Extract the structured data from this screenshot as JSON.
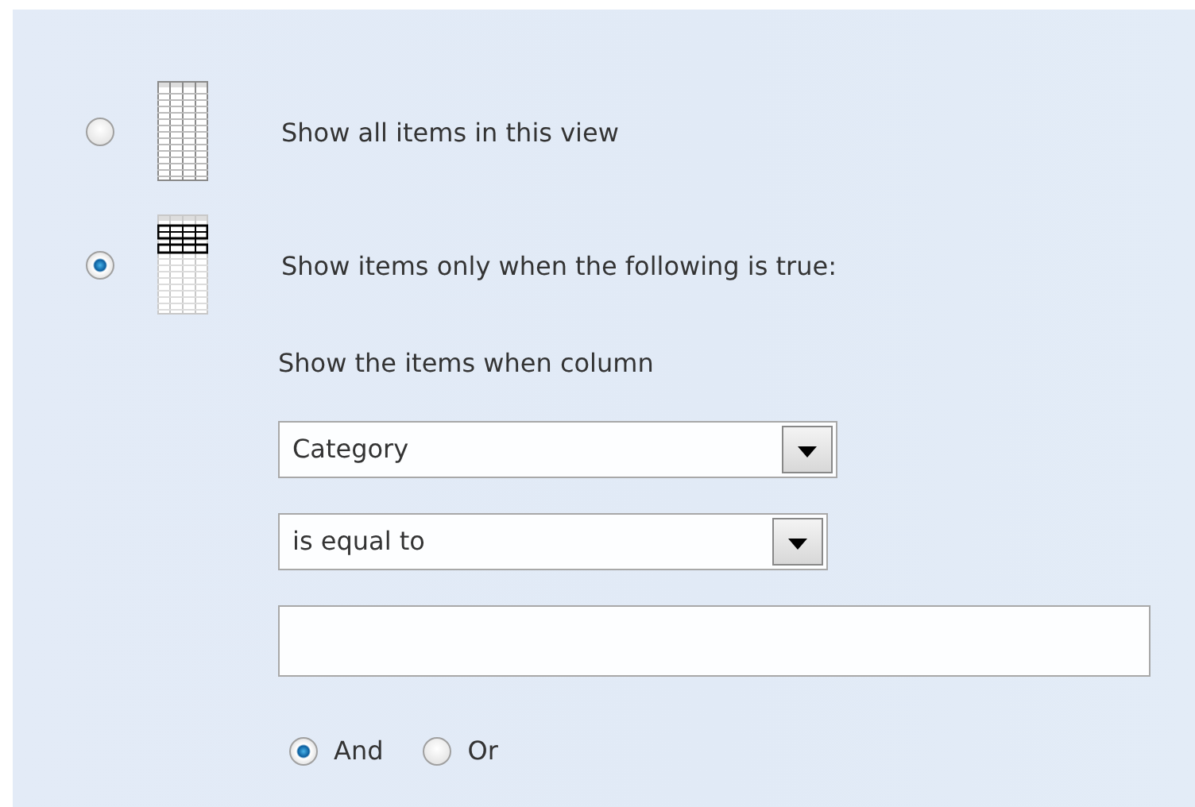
{
  "filter_options": [
    {
      "kind": "all",
      "label": "Show all items in this view",
      "selected": false
    },
    {
      "kind": "conditional",
      "label": "Show items only when the following is true:",
      "selected": true
    }
  ],
  "condition": {
    "prompt": "Show the items when column",
    "column_select": {
      "value": "Category"
    },
    "operator_select": {
      "value": "is equal to"
    },
    "joiners": [
      {
        "label": "And",
        "selected": true
      },
      {
        "label": "Or",
        "selected": false
      }
    ]
  }
}
